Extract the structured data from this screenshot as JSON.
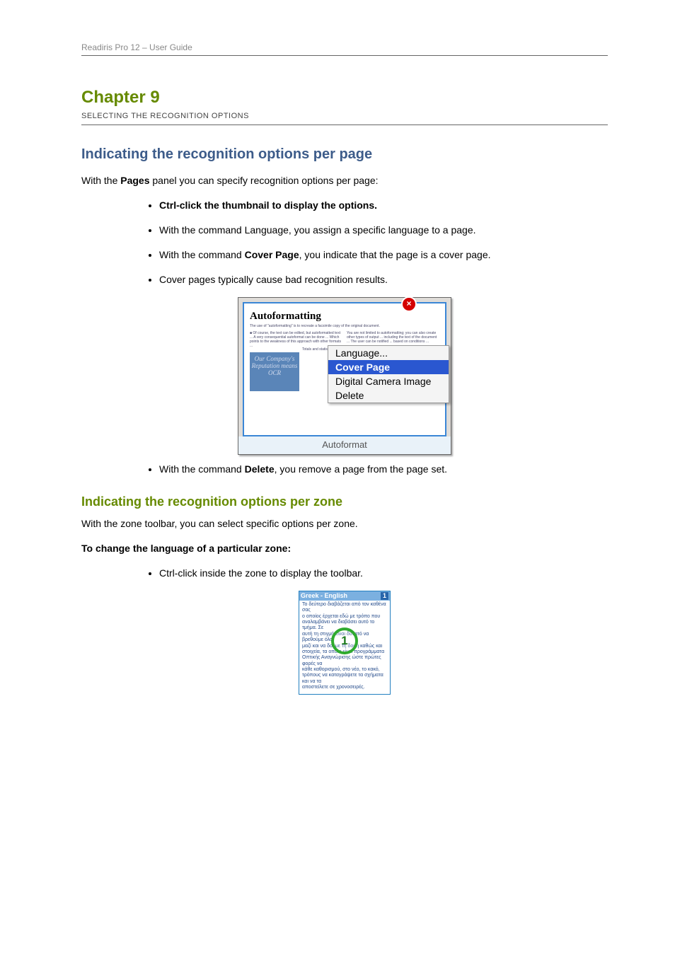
{
  "header": {
    "left": "Readiris Pro 12 – User Guide",
    "right": ""
  },
  "chapter": {
    "title": "Chapter 9",
    "subtitle": "SELECTING THE RECOGNITION OPTIONS"
  },
  "section1": {
    "title": "Indicating the recognition options per page",
    "p1_prefix": "With the ",
    "p1_bold1": "Pages",
    "p1_mid": " panel you can specify recognition options per page:",
    "bullets": {
      "b1_prefix": "Ctrl-click the thumbnail to display the options.",
      "b2": "With the command Language, you assign a specific language to a page.",
      "b3_prefix": "With the command ",
      "b3_bold": "Cover Page",
      "b3_suffix": ", you indicate that the page is a cover page.",
      "b4": "Cover pages typically cause bad recognition results.",
      "b5_prefix": "With the command ",
      "b5_bold": "Delete",
      "b5_suffix": ", you remove a page from the page set."
    }
  },
  "shot1": {
    "close": "×",
    "pagetitle": "Autoformatting",
    "imgwords": "Our Company's Reputation means OCR",
    "label": "Autoformat",
    "menu": {
      "language": "Language...",
      "cover": "Cover Page",
      "camera": "Digital Camera Image",
      "delete": "Delete"
    }
  },
  "section2": {
    "title": "Indicating the recognition options per zone",
    "p1": "With the zone toolbar, you can select specific options per zone.",
    "p2": "To change the language of a particular zone:",
    "bullet1": "Ctrl-click inside the zone to display the toolbar."
  },
  "shot2": {
    "hdr": "Greek - English",
    "num": "1"
  }
}
